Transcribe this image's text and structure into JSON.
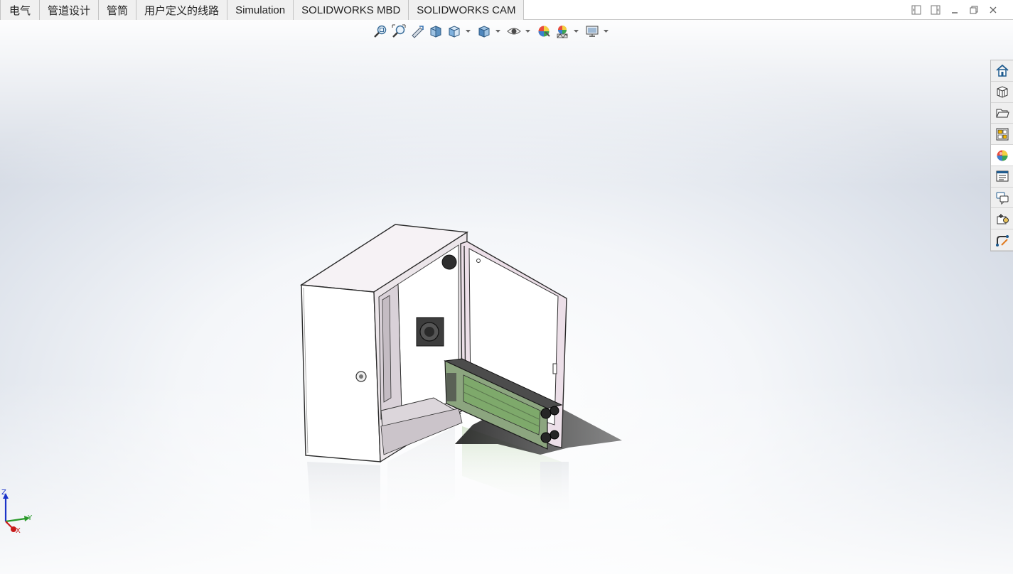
{
  "tabs": [
    {
      "label": "电气",
      "cjk": true
    },
    {
      "label": "管道设计",
      "cjk": true
    },
    {
      "label": "管筒",
      "cjk": true
    },
    {
      "label": "用户定义的线路",
      "cjk": true
    },
    {
      "label": "Simulation",
      "cjk": false
    },
    {
      "label": "SOLIDWORKS MBD",
      "cjk": false
    },
    {
      "label": "SOLIDWORKS CAM",
      "cjk": false
    }
  ],
  "window_controls": [
    "tile-left-icon",
    "tile-right-icon",
    "minimize-icon",
    "restore-icon",
    "close-icon"
  ],
  "heads_up_toolbar": [
    "zoom-to-fit-icon",
    "zoom-to-area-icon",
    "previous-view-icon",
    "section-view-icon",
    "view-orientation-icon",
    "display-style-icon",
    "hide-show-items-icon",
    "edit-appearance-icon",
    "apply-scene-icon",
    "view-settings-icon"
  ],
  "task_pane": [
    {
      "name": "solidworks-resources-icon",
      "active": false
    },
    {
      "name": "design-library-icon",
      "active": false
    },
    {
      "name": "file-explorer-icon",
      "active": false
    },
    {
      "name": "view-palette-icon",
      "active": false
    },
    {
      "name": "appearances-scenes-icon",
      "active": true
    },
    {
      "name": "custom-properties-icon",
      "active": false
    },
    {
      "name": "forum-icon",
      "active": false
    },
    {
      "name": "add-ins-icon",
      "active": false
    },
    {
      "name": "routing-library-icon",
      "active": false
    }
  ],
  "triad": {
    "z": "Z",
    "y": "Y",
    "x": "X"
  },
  "colors": {
    "accent": "#1c6fb8",
    "tab_bg": "#f0f0f0",
    "taskpane_bg": "#efefef"
  }
}
